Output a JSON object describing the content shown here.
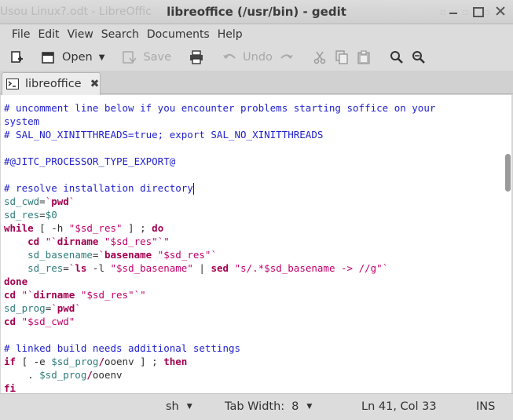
{
  "titlebar": {
    "background_title": "Usou Linux?.odt - LibreOffic",
    "title": "libreoffice (/usr/bin) - gedit"
  },
  "menu": {
    "items": [
      {
        "label": "File"
      },
      {
        "label": "Edit"
      },
      {
        "label": "View"
      },
      {
        "label": "Search"
      },
      {
        "label": "Documents"
      },
      {
        "label": "Help"
      }
    ]
  },
  "toolbar": {
    "open_label": "Open",
    "save_label": "Save",
    "undo_label": "Undo"
  },
  "tabs": [
    {
      "label": "libreoffice",
      "icon": "terminal-icon"
    }
  ],
  "editor": {
    "language": "sh",
    "lines": [
      [
        [
          "# uncomment line below if you encounter problems starting soffice on your",
          "c"
        ]
      ],
      [
        [
          "system",
          "c"
        ]
      ],
      [
        [
          "# SAL_NO_XINITTHREADS=true; export SAL_NO_XINITTHREADS",
          "c"
        ]
      ],
      [
        [
          "",
          "p"
        ]
      ],
      [
        [
          "#@JITC_PROCESSOR_TYPE_EXPORT@",
          "c"
        ]
      ],
      [
        [
          "",
          "p"
        ]
      ],
      [
        [
          "# resolve installation directory",
          "c"
        ],
        [
          "|caret|",
          "caret"
        ]
      ],
      [
        [
          "sd_cwd",
          "v"
        ],
        [
          "=",
          "p"
        ],
        [
          "`",
          "s"
        ],
        [
          "pwd",
          "k"
        ],
        [
          "`",
          "s"
        ]
      ],
      [
        [
          "sd_res",
          "v"
        ],
        [
          "=",
          "p"
        ],
        [
          "$0",
          "v"
        ]
      ],
      [
        [
          "while",
          "k"
        ],
        [
          " [ -h ",
          "p"
        ],
        [
          "\"$sd_res\"",
          "s"
        ],
        [
          " ] ; ",
          "p"
        ],
        [
          "do",
          "k"
        ]
      ],
      [
        [
          "    ",
          "p"
        ],
        [
          "cd",
          "k"
        ],
        [
          " ",
          "p"
        ],
        [
          "\"`",
          "s"
        ],
        [
          "dirname",
          "k"
        ],
        [
          " \"$sd_res\"`\"",
          "s"
        ]
      ],
      [
        [
          "    ",
          "p"
        ],
        [
          "sd_basename",
          "v"
        ],
        [
          "=",
          "p"
        ],
        [
          "`",
          "s"
        ],
        [
          "basename",
          "k"
        ],
        [
          " \"$sd_res\"`",
          "s"
        ]
      ],
      [
        [
          "    ",
          "p"
        ],
        [
          "sd_res",
          "v"
        ],
        [
          "=",
          "p"
        ],
        [
          "`",
          "s"
        ],
        [
          "ls",
          "k"
        ],
        [
          " -l ",
          "p"
        ],
        [
          "\"$sd_basename\"",
          "s"
        ],
        [
          " | ",
          "p"
        ],
        [
          "sed",
          "k"
        ],
        [
          " ",
          "p"
        ],
        [
          "\"s/.*$sd_basename -> //g\"`",
          "s"
        ]
      ],
      [
        [
          "done",
          "k"
        ]
      ],
      [
        [
          "cd",
          "k"
        ],
        [
          " ",
          "p"
        ],
        [
          "\"`",
          "s"
        ],
        [
          "dirname",
          "k"
        ],
        [
          " \"$sd_res\"`\"",
          "s"
        ]
      ],
      [
        [
          "sd_prog",
          "v"
        ],
        [
          "=",
          "p"
        ],
        [
          "`",
          "s"
        ],
        [
          "pwd",
          "k"
        ],
        [
          "`",
          "s"
        ]
      ],
      [
        [
          "cd",
          "k"
        ],
        [
          " ",
          "p"
        ],
        [
          "\"$sd_cwd\"",
          "s"
        ]
      ],
      [
        [
          "",
          "p"
        ]
      ],
      [
        [
          "# linked build needs additional settings",
          "c"
        ]
      ],
      [
        [
          "if",
          "k"
        ],
        [
          " [ -e ",
          "p"
        ],
        [
          "$sd_prog",
          "v"
        ],
        [
          "/",
          "k"
        ],
        [
          "ooenv ] ; ",
          "p"
        ],
        [
          "then",
          "k"
        ]
      ],
      [
        [
          "    . ",
          "p"
        ],
        [
          "$sd_prog",
          "v"
        ],
        [
          "/",
          "k"
        ],
        [
          "ooenv",
          "p"
        ]
      ],
      [
        [
          "fi",
          "k"
        ]
      ]
    ]
  },
  "status": {
    "language": "sh",
    "tab_width_label": "Tab Width:",
    "tab_width_value": "8",
    "position": "Ln 41, Col 33",
    "mode": "INS"
  },
  "colors": {
    "comment": "#2222cc",
    "keyword": "#a1004f",
    "variable": "#2f7c7c",
    "string": "#c0006a"
  }
}
